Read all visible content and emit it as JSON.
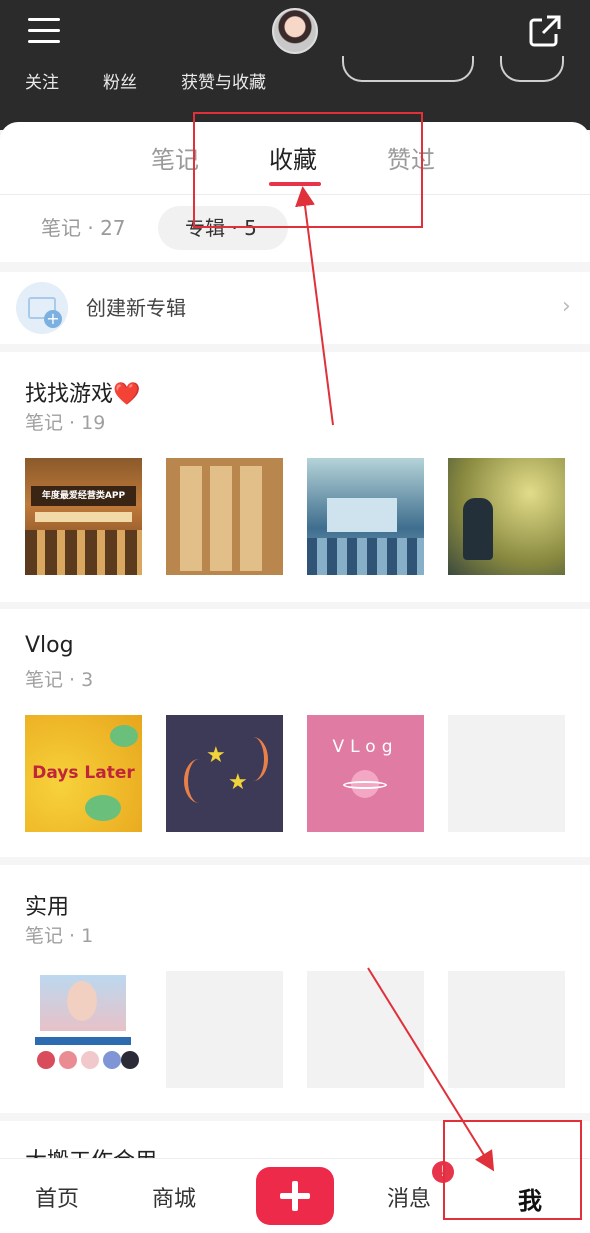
{
  "header": {
    "stats": [
      "关注",
      "粉丝",
      "获赞与收藏"
    ]
  },
  "tabs": [
    "笔记",
    "收藏",
    "赞过"
  ],
  "subtabs": [
    {
      "label": "笔记 · 27"
    },
    {
      "label": "专辑 · 5"
    }
  ],
  "create_album": {
    "label": "创建新专辑"
  },
  "albums": [
    {
      "title": "找找游戏❤️",
      "count": "笔记  ·  19"
    },
    {
      "title": "Vlog",
      "count": "笔记  ·  3"
    },
    {
      "title": "实用",
      "count": "笔记  ·  1"
    },
    {
      "title": "大搬工作合用",
      "count": ""
    }
  ],
  "thumb_text": {
    "game_app": "年度最爱经营类APP",
    "days_later": "Days Later",
    "vlog": "VLog"
  },
  "nav": [
    "首页",
    "商城",
    "消息",
    "我"
  ],
  "badge": "!",
  "colors": {
    "accent": "#e8344a",
    "annotation": "#e0303a"
  }
}
